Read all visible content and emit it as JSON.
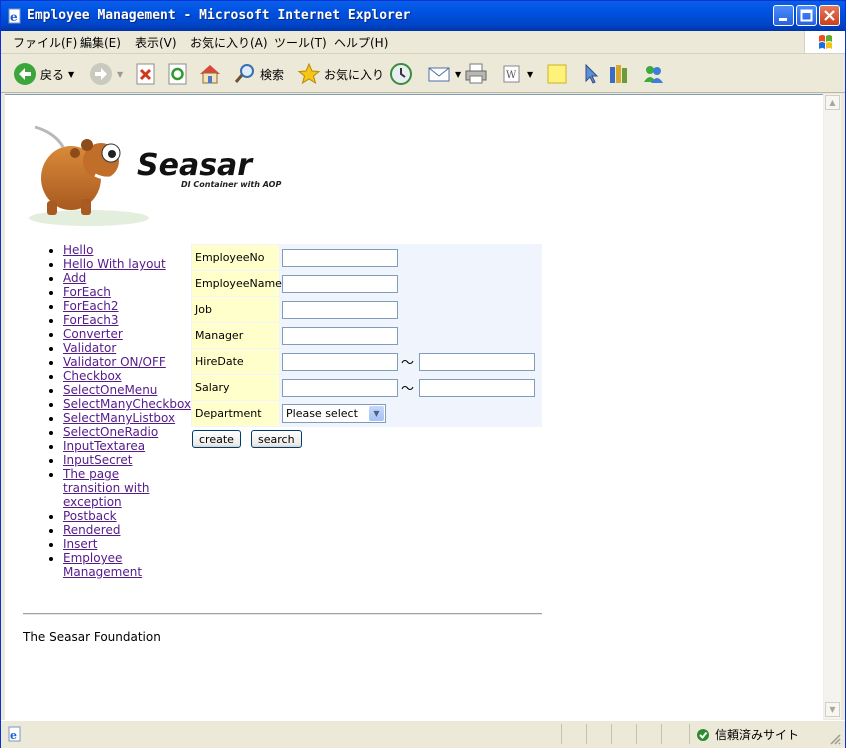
{
  "window": {
    "title": "Employee Management - Microsoft Internet Explorer"
  },
  "menu": [
    "ファイル(F)",
    "編集(E)",
    "表示(V)",
    "お気に入り(A)",
    "ツール(T)",
    "ヘルプ(H)"
  ],
  "toolbar": {
    "back_label": "戻る",
    "search_label": "検索",
    "favorites_label": "お気に入り"
  },
  "logo": {
    "name": "Seasar",
    "tagline": "DI Container with AOP"
  },
  "nav": [
    "Hello",
    "Hello With layout",
    "Add",
    "ForEach",
    "ForEach2",
    "ForEach3",
    "Converter",
    "Validator",
    "Validator ON/OFF",
    "Checkbox",
    "SelectOneMenu",
    "SelectManyCheckbox",
    "SelectManyListbox",
    "SelectOneRadio",
    "InputTextarea",
    "InputSecret",
    "The page transition with exception",
    "Postback",
    "Rendered",
    "Insert",
    "Employee Management"
  ],
  "form": {
    "employee_no_label": "EmployeeNo",
    "employee_name_label": "EmployeeName",
    "job_label": "Job",
    "manager_label": "Manager",
    "hire_date_label": "HireDate",
    "salary_label": "Salary",
    "department_label": "Department",
    "range_separator": "〜",
    "department_selected": "Please select",
    "create_label": "create",
    "search_label": "search"
  },
  "footer": {
    "text": "The Seasar Foundation"
  },
  "status": {
    "zone": "信頼済みサイト"
  }
}
